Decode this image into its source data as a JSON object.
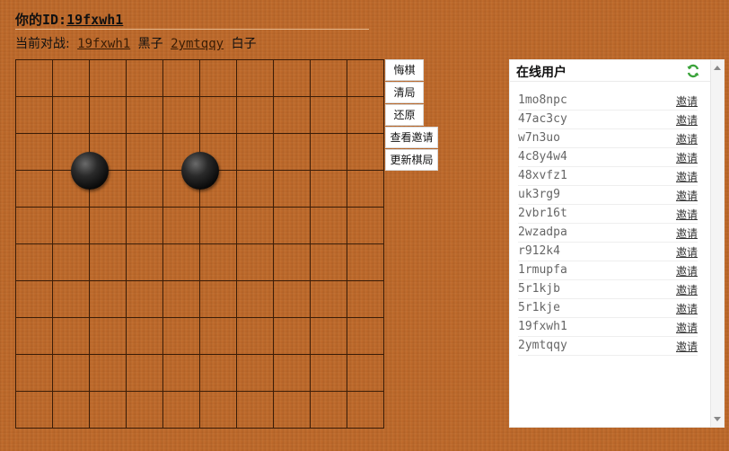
{
  "header": {
    "id_label": "你的ID:",
    "my_id": "19fxwh1"
  },
  "match": {
    "label": "当前对战:",
    "black_player": "19fxwh1",
    "black_label": "黑子",
    "white_player": "2ymtqqy",
    "white_label": "白子"
  },
  "board": {
    "grid_size": 10,
    "stones": [
      {
        "color": "black",
        "col": 2,
        "row": 3
      },
      {
        "color": "black",
        "col": 5,
        "row": 3
      }
    ]
  },
  "buttons": {
    "undo": "悔棋",
    "clear": "清局",
    "restore": "还原",
    "view_invites": "查看邀请",
    "update_board": "更新棋局"
  },
  "users_panel": {
    "title": "在线用户",
    "invite_label": "邀请",
    "users": [
      "1mo8npc",
      "47ac3cy",
      "w7n3uo",
      "4c8y4w4",
      "48xvfz1",
      "uk3rg9",
      "2vbr16t",
      "2wzadpa",
      "r912k4",
      "1rmupfa",
      "5r1kjb",
      "5r1kje",
      "19fxwh1",
      "2ymtqqy"
    ]
  },
  "colors": {
    "background": "#bf6a2a",
    "grid_line": "#3a1c07",
    "stone_black": "#111111",
    "refresh_green": "#3aa33a"
  }
}
